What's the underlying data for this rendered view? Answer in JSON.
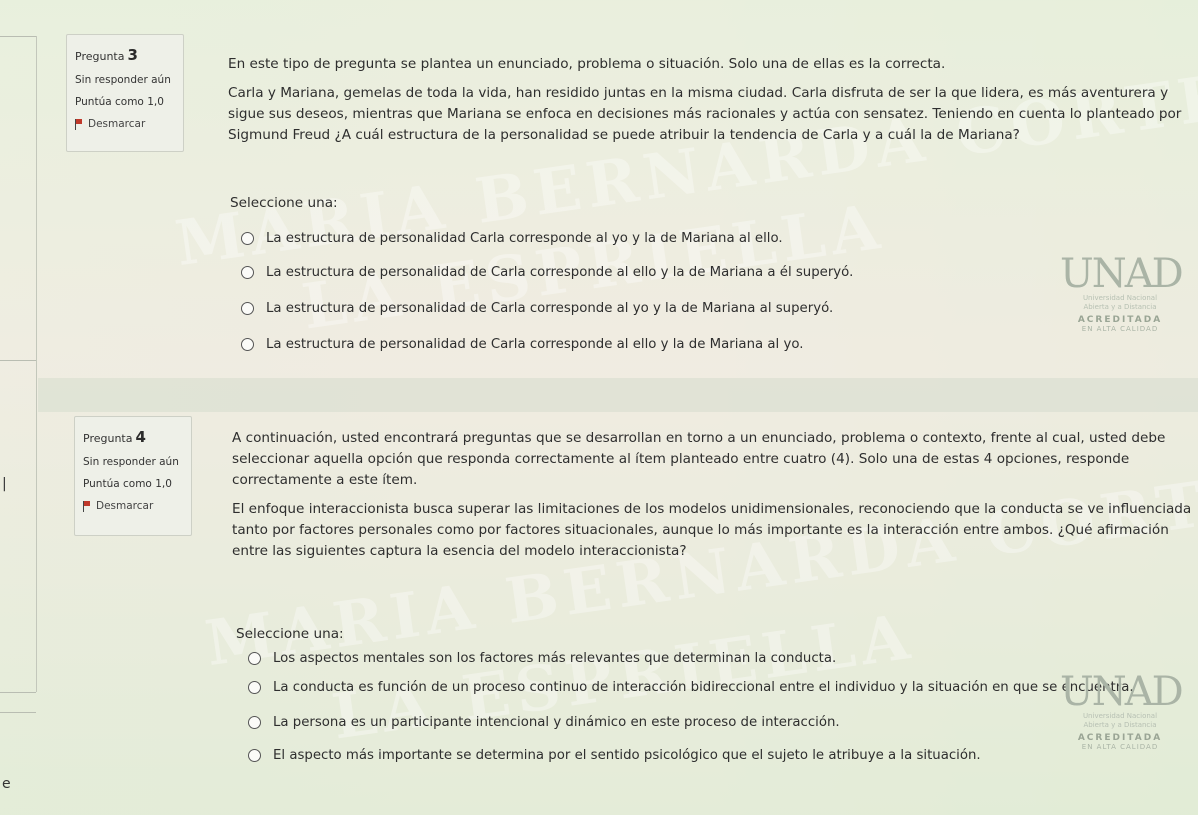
{
  "q3": {
    "label": "Pregunta",
    "number": "3",
    "status": "Sin responder aún",
    "score": "Puntúa como 1,0",
    "flag": "Desmarcar",
    "prompt": [
      "En este tipo de pregunta se plantea un enunciado, problema o situación. Solo una de ellas es la correcta.",
      "Carla y Mariana, gemelas de toda la vida, han residido juntas en la misma ciudad. Carla disfruta de ser la que lidera, es más aventurera y",
      "sigue sus deseos, mientras que Mariana se enfoca en decisiones más racionales y actúa con sensatez. Teniendo en cuenta lo planteado por",
      "Sigmund Freud ¿A cuál estructura de la personalidad se puede atribuir la tendencia de Carla y a cuál la de Mariana?"
    ],
    "select_label": "Seleccione una:",
    "options": [
      "La estructura de personalidad Carla corresponde al yo y la de Mariana al ello.",
      "La estructura de personalidad de Carla corresponde al ello y la de Mariana a él superyó.",
      "La estructura de personalidad de Carla corresponde al yo y la de Mariana al superyó.",
      "La estructura de personalidad de Carla corresponde al ello y la de Mariana al yo."
    ]
  },
  "q4": {
    "label": "Pregunta",
    "number": "4",
    "status": "Sin responder aún",
    "score": "Puntúa como 1,0",
    "flag": "Desmarcar",
    "prompt": [
      "A continuación, usted encontrará preguntas que se desarrollan en torno a un enunciado, problema o contexto, frente al cual, usted debe",
      "seleccionar aquella opción que responda correctamente al ítem planteado entre cuatro (4). Solo una de estas 4 opciones, responde",
      "correctamente a este ítem.",
      "El enfoque interaccionista busca superar las limitaciones de los modelos unidimensionales, reconociendo que la conducta se ve influenciada",
      "tanto por factores personales como por factores situacionales, aunque lo más importante es la interacción entre ambos. ¿Qué afirmación",
      "entre las siguientes captura la esencia del modelo interaccionista?"
    ],
    "select_label": "Seleccione una:",
    "options": [
      "Los aspectos mentales son los factores más relevantes que determinan la conducta.",
      "La conducta es función de un proceso continuo de interacción bidireccional entre el individuo y la situación en que se encuentra.",
      "La persona es un participante intencional y dinámico en este proceso de interacción.",
      "El aspecto más importante se determina por el sentido psicológico que el sujeto le atribuye a la situación."
    ]
  },
  "logo": {
    "mark": "UNAD",
    "line1": "Universidad Nacional",
    "line2": "Abierta y a Distancia",
    "accredited": "ACREDITADA",
    "quality": "EN ALTA CALIDAD"
  },
  "watermark": {
    "line1": "MARIA BERNARDA CORTES DE",
    "line2": "LA ESPRIELLA"
  },
  "left_edge": {
    "char1": "|",
    "char2": "e"
  }
}
